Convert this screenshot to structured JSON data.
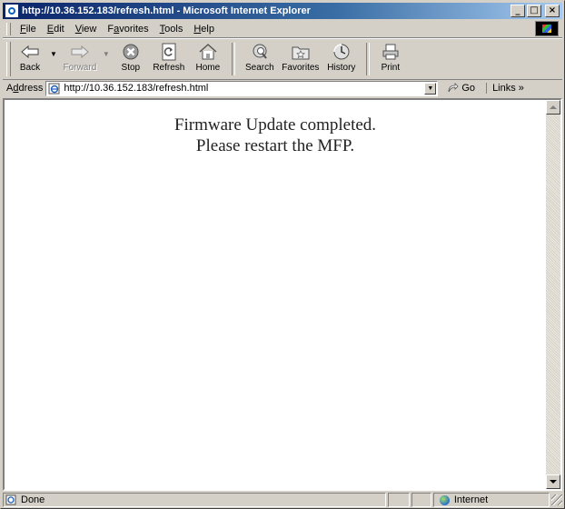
{
  "window": {
    "title": "http://10.36.152.183/refresh.html - Microsoft Internet Explorer",
    "buttons": {
      "minimize": "_",
      "maximize": "□",
      "close": "×"
    }
  },
  "menubar": {
    "items": [
      {
        "pre": "",
        "key": "F",
        "post": "ile"
      },
      {
        "pre": "",
        "key": "E",
        "post": "dit"
      },
      {
        "pre": "",
        "key": "V",
        "post": "iew"
      },
      {
        "pre": "F",
        "key": "a",
        "post": "vorites"
      },
      {
        "pre": "",
        "key": "T",
        "post": "ools"
      },
      {
        "pre": "",
        "key": "H",
        "post": "elp"
      }
    ]
  },
  "toolbar": {
    "back": "Back",
    "forward": "Forward",
    "stop": "Stop",
    "refresh": "Refresh",
    "home": "Home",
    "search": "Search",
    "favorites": "Favorites",
    "history": "History",
    "print": "Print"
  },
  "addressbar": {
    "label_pre": "A",
    "label_key": "d",
    "label_post": "dress",
    "url": "http://10.36.152.183/refresh.html",
    "go": "Go",
    "links": "Links »"
  },
  "page": {
    "line1": "Firmware Update completed.",
    "line2": "Please restart the MFP."
  },
  "statusbar": {
    "status": "Done",
    "zone": "Internet"
  }
}
